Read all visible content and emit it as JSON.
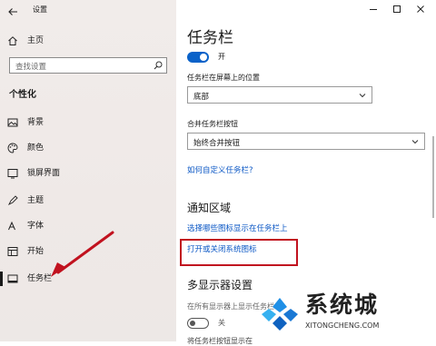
{
  "window": {
    "title": "设置",
    "controls": [
      "minimize",
      "maximize",
      "close"
    ]
  },
  "sidebar": {
    "home_label": "主页",
    "search_placeholder": "查找设置",
    "section_title": "个性化",
    "items": [
      {
        "label": "背景",
        "icon": "image-icon"
      },
      {
        "label": "颜色",
        "icon": "palette-icon"
      },
      {
        "label": "锁屏界面",
        "icon": "lock-screen-icon"
      },
      {
        "label": "主题",
        "icon": "theme-icon"
      },
      {
        "label": "字体",
        "icon": "font-icon"
      },
      {
        "label": "开始",
        "icon": "start-icon"
      },
      {
        "label": "任务栏",
        "icon": "taskbar-icon",
        "active": true
      }
    ]
  },
  "main": {
    "title": "任务栏",
    "toggle_state_label": "开",
    "position_label": "任务栏在屏幕上的位置",
    "position_value": "底部",
    "combine_label": "合并任务栏按钮",
    "combine_value": "始终合并按钮",
    "customize_link": "如何自定义任务栏?",
    "notify_title": "通知区域",
    "notify_link1": "选择哪些图标显示在任务栏上",
    "notify_link2": "打开或关闭系统图标",
    "multi_title": "多显示器设置",
    "multi_desc": "在所有显示器上显示任务栏",
    "multi_toggle_label": "关",
    "bottom_cut": "将任务栏按钮显示在"
  },
  "watermark": {
    "brand": "系统城",
    "url": "XITONGCHENG.COM"
  },
  "colors": {
    "accent": "#0a62c9",
    "link": "#0b57c5",
    "highlight": "#c1121f",
    "arrow": "#c1121f"
  }
}
